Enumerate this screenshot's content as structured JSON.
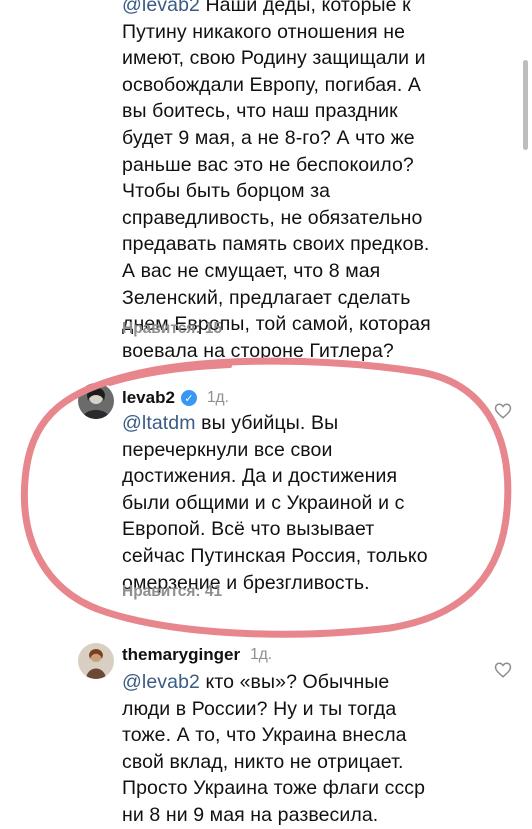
{
  "comment1": {
    "mention": "@levab2",
    "text": " Наши деды, которые к\nПутину никакого отношения не\nимеют, свою Родину защищали и\nосвобождали Европу, погибая. А\nвы боитесь, что наш праздник\nбудет 9 мая, а не 8-го? А что же\nраньше вас это не беспокоило?\nЧтобы быть борцом за\nсправедливость, не обязательно\nпредавать память своих предков.\nА вас не смущает, что 8 мая\nЗеленский, предлагает сделать\nднем Европы, той самой, которая\nвоевала на стороне Гитлера?",
    "likes": "Нравится: 15"
  },
  "comment2": {
    "username": "levab2",
    "time": "1д.",
    "mention": "@ltatdm",
    "text": " вы убийцы. Вы\nперечеркнули все свои\nдостижения. Да и достижения\nбыли общими и с Украиной и с\nЕвропой. Всё что вызывает\nсейчас Путинская Россия, только\nомерзение и брезгливость.",
    "likes": "Нравится: 41",
    "verified_icon": "verified-badge"
  },
  "comment3": {
    "username": "themaryginger",
    "time": "1д.",
    "mention": "@levab2",
    "text": " кто «вы»? Обычные\nлюди в России? Ну и ты тогда\nтоже. А то, что Украина внесла\nсвой вклад, никто не отрицает.\nПросто Украина тоже флаги ссср\nни 8 ни 9 мая на развесила."
  },
  "colors": {
    "annotation": "#e8868d",
    "mention": "#3b5b86",
    "muted": "#8e8e8e"
  }
}
